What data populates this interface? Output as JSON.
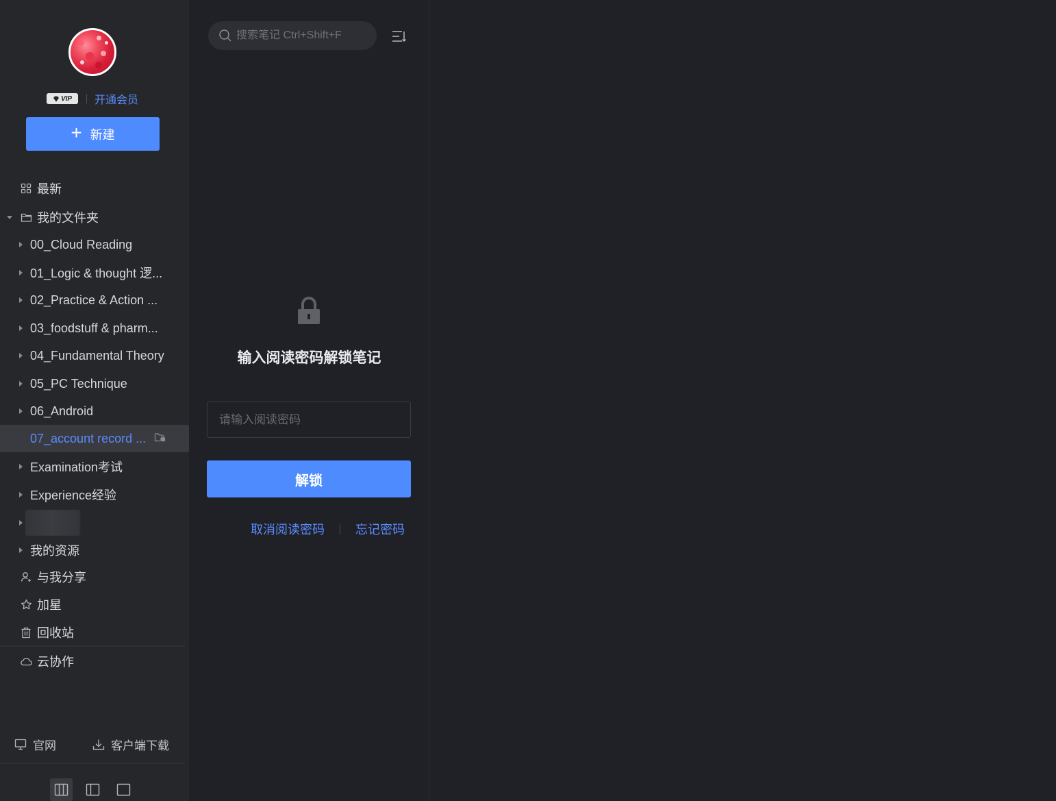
{
  "sidebar": {
    "vip_badge": "VIP",
    "vip_link": "开通会员",
    "new_button": "新建",
    "recent": "最新",
    "my_folders": "我的文件夹",
    "folders": [
      {
        "label": "00_Cloud Reading"
      },
      {
        "label": "01_Logic & thought 逻..."
      },
      {
        "label": "02_Practice & Action ..."
      },
      {
        "label": "03_foodstuff & pharm..."
      },
      {
        "label": "04_Fundamental Theory"
      },
      {
        "label": "05_PC Technique"
      },
      {
        "label": "06_Android"
      },
      {
        "label": "07_account record ...",
        "active": true
      },
      {
        "label": "Examination考试"
      },
      {
        "label": "Experience经验"
      },
      {
        "label": ""
      },
      {
        "label": "我的资源"
      }
    ],
    "shared": "与我分享",
    "starred": "加星",
    "trash": "回收站",
    "cloud": "云协作",
    "footer": {
      "website": "官网",
      "download": "客户端下载"
    }
  },
  "middle": {
    "search_placeholder": "搜索笔记 Ctrl+Shift+F",
    "unlock_title": "输入阅读密码解锁笔记",
    "password_placeholder": "请输入阅读密码",
    "unlock_button": "解锁",
    "cancel_password": "取消阅读密码",
    "forgot_password": "忘记密码"
  },
  "colors": {
    "accent": "#4e8bff",
    "link": "#5b8cff",
    "sidebar_bg": "#26272b",
    "main_bg": "#202126"
  }
}
